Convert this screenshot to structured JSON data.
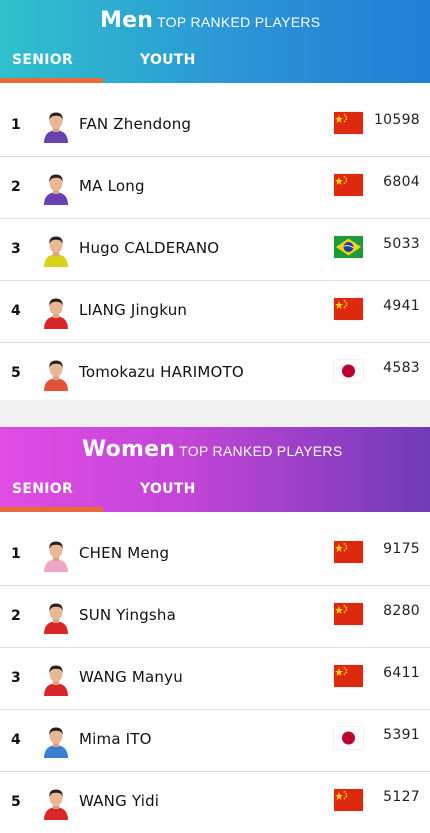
{
  "men": {
    "title": "Men",
    "subtitle": "TOP RANKED PLAYERS",
    "tabs": [
      {
        "label": "SENIOR",
        "active": true
      },
      {
        "label": "YOUTH",
        "active": false
      }
    ],
    "players": [
      {
        "rank": "1",
        "name": "FAN Zhendong",
        "flag": "china-flag",
        "points": "10598",
        "shirt": "#6a3fb0"
      },
      {
        "rank": "2",
        "name": "MA Long",
        "flag": "china-flag",
        "points": "6804",
        "shirt": "#6a3fb0"
      },
      {
        "rank": "3",
        "name": "Hugo CALDERANO",
        "flag": "brazil-flag",
        "points": "5033",
        "shirt": "#d8d21a"
      },
      {
        "rank": "4",
        "name": "LIANG Jingkun",
        "flag": "china-flag",
        "points": "4941",
        "shirt": "#d8262a"
      },
      {
        "rank": "5",
        "name": "Tomokazu HARIMOTO",
        "flag": "japan-flag",
        "points": "4583",
        "shirt": "#e2533a"
      }
    ]
  },
  "women": {
    "title": "Women",
    "subtitle": "TOP RANKED PLAYERS",
    "tabs": [
      {
        "label": "SENIOR",
        "active": true
      },
      {
        "label": "YOUTH",
        "active": false
      }
    ],
    "players": [
      {
        "rank": "1",
        "name": "CHEN Meng",
        "flag": "china-flag",
        "points": "9175",
        "shirt": "#f0a6c6"
      },
      {
        "rank": "2",
        "name": "SUN Yingsha",
        "flag": "china-flag",
        "points": "8280",
        "shirt": "#d8262a"
      },
      {
        "rank": "3",
        "name": "WANG Manyu",
        "flag": "china-flag",
        "points": "6411",
        "shirt": "#d8262a"
      },
      {
        "rank": "4",
        "name": "Mima ITO",
        "flag": "japan-flag",
        "points": "5391",
        "shirt": "#3a7fd0"
      },
      {
        "rank": "5",
        "name": "WANG Yidi",
        "flag": "china-flag",
        "points": "5127",
        "shirt": "#d8262a"
      }
    ]
  },
  "colors": {
    "accent_underline": "#ea6b3a",
    "men_header": "#2b95d6",
    "women_header": "#c145d6"
  }
}
